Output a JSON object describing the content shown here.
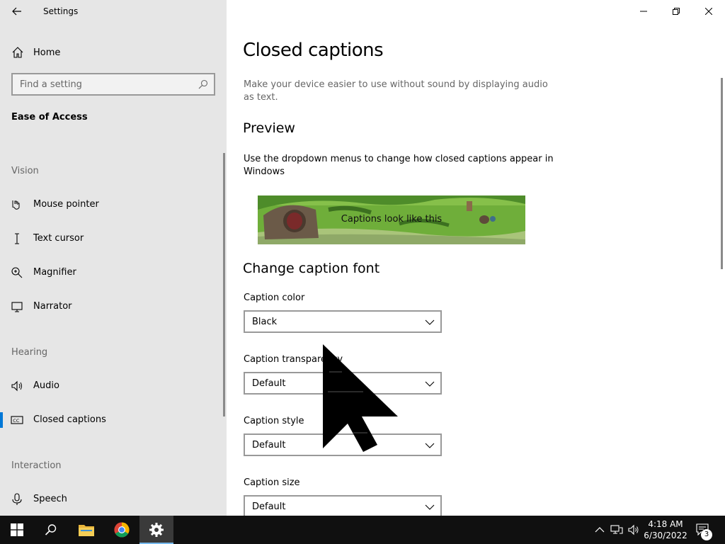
{
  "window": {
    "app_title": "Settings",
    "controls": [
      "minimize-icon",
      "restore-icon",
      "close-icon"
    ]
  },
  "sidebar": {
    "home_label": "Home",
    "search_placeholder": "Find a setting",
    "section_title": "Ease of Access",
    "groups": [
      {
        "label": "Vision",
        "items": [
          {
            "label": "Mouse pointer",
            "icon": "mouse-pointer-icon"
          },
          {
            "label": "Text cursor",
            "icon": "text-cursor-icon"
          },
          {
            "label": "Magnifier",
            "icon": "magnifier-icon"
          },
          {
            "label": "Narrator",
            "icon": "narrator-icon"
          }
        ]
      },
      {
        "label": "Hearing",
        "items": [
          {
            "label": "Audio",
            "icon": "speaker-icon"
          },
          {
            "label": "Closed captions",
            "icon": "closed-captions-icon",
            "active": true
          }
        ]
      },
      {
        "label": "Interaction",
        "items": [
          {
            "label": "Speech",
            "icon": "microphone-icon"
          }
        ]
      }
    ],
    "accent_color": "#0078d7"
  },
  "main": {
    "title": "Closed captions",
    "description": "Make your device easier to use without sound by displaying audio as text.",
    "preview": {
      "heading": "Preview",
      "text": "Use the dropdown menus to change how closed captions appear in Windows",
      "caption_sample": "Captions look like this"
    },
    "font_section": {
      "heading": "Change caption font",
      "fields": [
        {
          "label": "Caption color",
          "value": "Black"
        },
        {
          "label": "Caption transparency",
          "value": "Default"
        },
        {
          "label": "Caption style",
          "value": "Default"
        },
        {
          "label": "Caption size",
          "value": "Default"
        }
      ]
    }
  },
  "taskbar": {
    "apps": [
      "windows-start-icon",
      "search-icon",
      "file-explorer-icon",
      "chrome-icon",
      "settings-gear-icon"
    ],
    "active_app": "settings-gear-icon",
    "tray": [
      "chevron-up-icon",
      "network-icon",
      "volume-icon"
    ],
    "time": "4:18 AM",
    "date": "6/30/2022",
    "notification_count": "3"
  }
}
